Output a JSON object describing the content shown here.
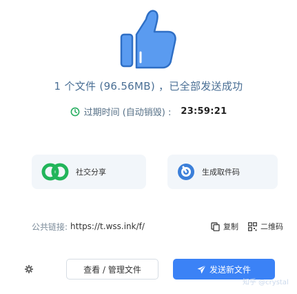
{
  "result": {
    "message": "1 个文件 (96.56MB) ，已全部发送成功",
    "expire_label": "过期时间 (自动销毁) :",
    "countdown": "23:59:21"
  },
  "share_options": {
    "social_label": "社交分享",
    "code_label": "生成取件码"
  },
  "link": {
    "label": "公共链接:",
    "url": "https://t.wss.ink/f/",
    "copy_label": "复制",
    "qr_label": "二维码"
  },
  "actions": {
    "manage_label": "查看 / 管理文件",
    "send_new_label": "发送新文件"
  },
  "watermark": "知乎 @crystal",
  "colors": {
    "accent": "#3b82f6",
    "thumb_fill": "#5a9bf0",
    "social_green": "#22b55a",
    "code_blue": "#3b7fd9"
  },
  "icons": [
    "thumbs-up-icon",
    "clock-icon",
    "share-icon",
    "code-icon",
    "copy-icon",
    "qr-icon",
    "gear-icon",
    "send-icon"
  ]
}
